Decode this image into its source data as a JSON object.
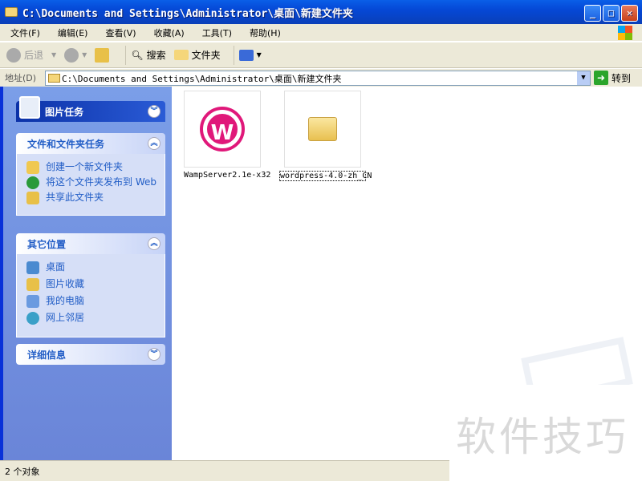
{
  "window": {
    "title": "C:\\Documents and Settings\\Administrator\\桌面\\新建文件夹"
  },
  "menu": [
    "文件(F)",
    "编辑(E)",
    "查看(V)",
    "收藏(A)",
    "工具(T)",
    "帮助(H)"
  ],
  "toolbar": {
    "back": "后退",
    "search": "搜索",
    "folders": "文件夹"
  },
  "address": {
    "label": "地址(D)",
    "value": "C:\\Documents and Settings\\Administrator\\桌面\\新建文件夹",
    "go": "转到"
  },
  "sidebar": {
    "picture_tasks": "图片任务",
    "file_tasks": {
      "title": "文件和文件夹任务",
      "items": [
        "创建一个新文件夹",
        "将这个文件夹发布到 Web",
        "共享此文件夹"
      ]
    },
    "other_places": {
      "title": "其它位置",
      "items": [
        "桌面",
        "图片收藏",
        "我的电脑",
        "网上邻居"
      ]
    },
    "details": "详细信息"
  },
  "files": [
    {
      "name": "WampServer2.1e-x32"
    },
    {
      "name": "wordpress-4.0-zh_CN"
    }
  ],
  "status": "2 个对象",
  "watermark": "软件技巧"
}
